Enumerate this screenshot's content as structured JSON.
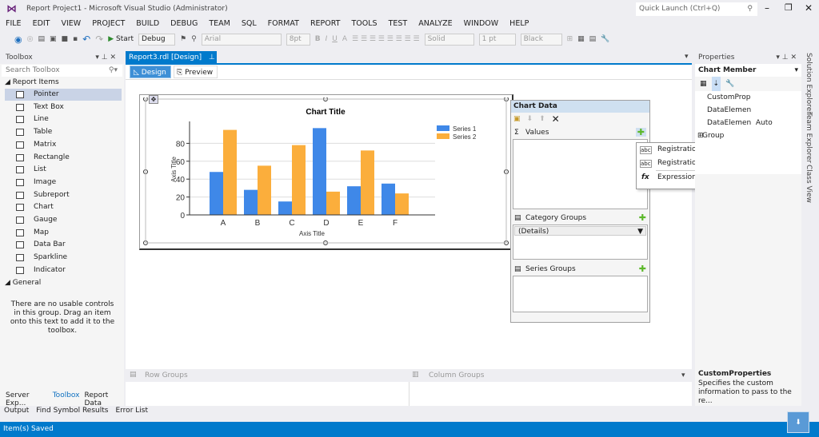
{
  "window": {
    "title": "Report Project1 - Microsoft Visual Studio (Administrator)",
    "quick_launch": "Quick Launch (Ctrl+Q)"
  },
  "menu": [
    "FILE",
    "EDIT",
    "VIEW",
    "PROJECT",
    "BUILD",
    "DEBUG",
    "TEAM",
    "SQL",
    "FORMAT",
    "REPORT",
    "TOOLS",
    "TEST",
    "ANALYZE",
    "WINDOW",
    "HELP"
  ],
  "toolbar": {
    "start": "Start",
    "config": "Debug",
    "font": "Arial",
    "size": "8pt",
    "line_style": "Solid",
    "line_width": "1 pt",
    "color": "Black"
  },
  "toolbox": {
    "title": "Toolbox",
    "search_placeholder": "Search Toolbox",
    "group1": "Report Items",
    "items": [
      "Pointer",
      "Text Box",
      "Line",
      "Table",
      "Matrix",
      "Rectangle",
      "List",
      "Image",
      "Subreport",
      "Chart",
      "Gauge",
      "Map",
      "Data Bar",
      "Sparkline",
      "Indicator"
    ],
    "group2": "General",
    "empty_text": "There are no usable controls in this group. Drag an item onto this text to add it to the toolbox.",
    "tabs": [
      "Server Exp...",
      "Toolbox",
      "Report Data"
    ]
  },
  "document": {
    "tab": "Report3.rdl [Design]",
    "design": "Design",
    "preview": "Preview",
    "row_groups": "Row Groups",
    "column_groups": "Column Groups"
  },
  "chart_data": {
    "type": "bar",
    "title": "Chart Title",
    "xlabel": "Axis Title",
    "ylabel": "Axis Title",
    "categories": [
      "A",
      "B",
      "C",
      "D",
      "E",
      "F"
    ],
    "ylim": [
      0,
      100
    ],
    "yticks": [
      0,
      20,
      40,
      60,
      80
    ],
    "grid": true,
    "legend": "top-right",
    "series": [
      {
        "name": "Series 1",
        "color": "#3f88e8",
        "values": [
          48,
          28,
          15,
          97,
          32,
          35
        ]
      },
      {
        "name": "Series 2",
        "color": "#fbae3c",
        "values": [
          95,
          55,
          78,
          26,
          72,
          24
        ]
      }
    ]
  },
  "chart_panel": {
    "title": "Chart Data",
    "values": "Values",
    "category_groups": "Category Groups",
    "details": "(Details)",
    "series_groups": "Series Groups"
  },
  "values_menu": [
    "RegistrationDate",
    "Registration_Count",
    "Expression..."
  ],
  "properties": {
    "title": "Properties",
    "object": "Chart Member",
    "rows": [
      {
        "name": "CustomProp",
        "value": ""
      },
      {
        "name": "DataElemen",
        "value": ""
      },
      {
        "name": "DataElemen",
        "value": "Auto"
      },
      {
        "name": "Group",
        "value": ""
      }
    ],
    "desc_title": "CustomProperties",
    "desc": "Specifies the custom information to pass to the re..."
  },
  "side_tabs": [
    "Solution Explorer",
    "Team Explorer",
    "Class View"
  ],
  "bottom_tabs": [
    "Output",
    "Find Symbol Results",
    "Error List"
  ],
  "status": "Item(s) Saved"
}
